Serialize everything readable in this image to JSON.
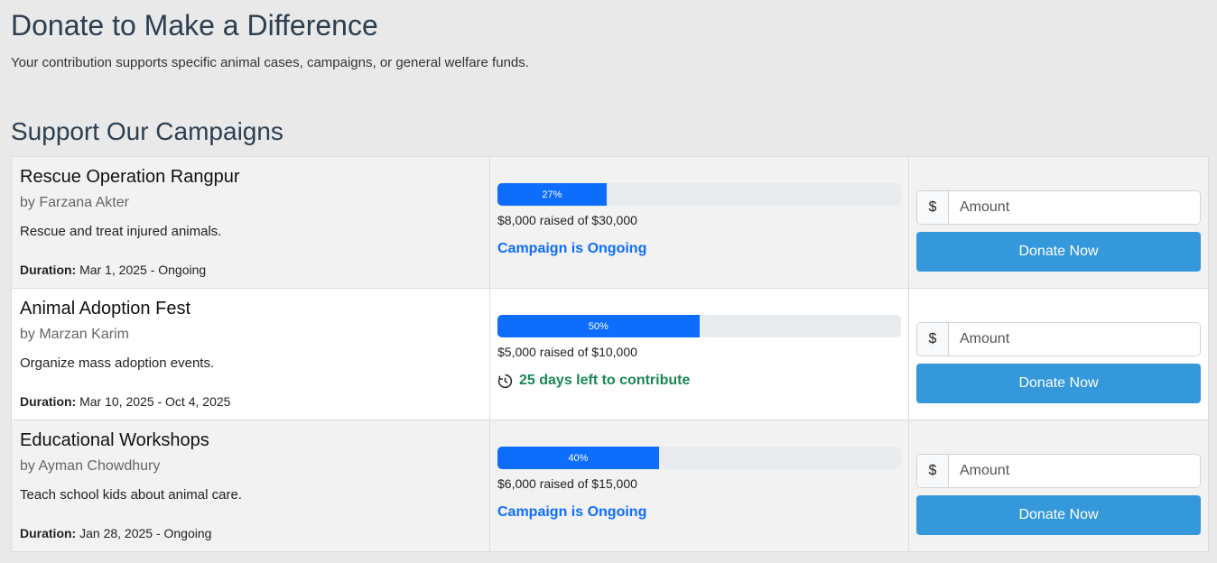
{
  "page": {
    "title": "Donate to Make a Difference",
    "subtitle": "Your contribution supports specific animal cases, campaigns, or general welfare funds.",
    "section_title": "Support Our Campaigns"
  },
  "colors": {
    "accent": "#0d6efd",
    "button": "#3498db",
    "success": "#198754"
  },
  "campaigns": [
    {
      "title": "Rescue Operation Rangpur",
      "author": "by Farzana Akter",
      "description": "Rescue and treat injured animals.",
      "duration_label": "Duration:",
      "duration": "Mar 1, 2025 - Ongoing",
      "progress_percent": 27,
      "progress_label": "27%",
      "raised_text": "$8,000 raised of $30,000",
      "status_text": "Campaign is Ongoing",
      "status_type": "ongoing",
      "currency": "$",
      "amount_placeholder": "Amount",
      "donate_label": "Donate Now"
    },
    {
      "title": "Animal Adoption Fest",
      "author": "by Marzan Karim",
      "description": "Organize mass adoption events.",
      "duration_label": "Duration:",
      "duration": "Mar 10, 2025 - Oct 4, 2025",
      "progress_percent": 50,
      "progress_label": "50%",
      "raised_text": "$5,000 raised of $10,000",
      "status_text": "25 days left to contribute",
      "status_type": "days",
      "status_icon": "clock-icon",
      "currency": "$",
      "amount_placeholder": "Amount",
      "donate_label": "Donate Now"
    },
    {
      "title": "Educational Workshops",
      "author": "by Ayman Chowdhury",
      "description": "Teach school kids about animal care.",
      "duration_label": "Duration:",
      "duration": "Jan 28, 2025 - Ongoing",
      "progress_percent": 40,
      "progress_label": "40%",
      "raised_text": "$6,000 raised of $15,000",
      "status_text": "Campaign is Ongoing",
      "status_type": "ongoing",
      "currency": "$",
      "amount_placeholder": "Amount",
      "donate_label": "Donate Now"
    }
  ]
}
